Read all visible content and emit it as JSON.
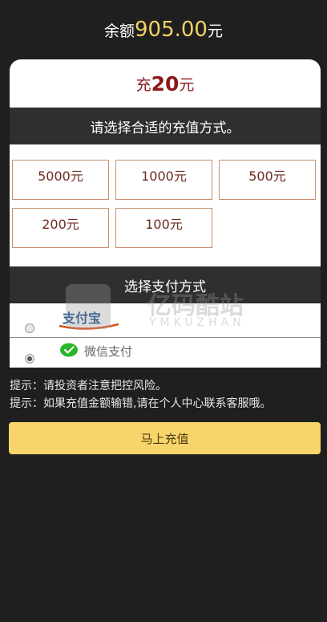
{
  "header": {
    "prefix": "余额",
    "amount": "905.00",
    "suffix": "元"
  },
  "charge": {
    "prefix": "充",
    "amount": "20",
    "suffix": "元"
  },
  "amount_section": {
    "title": "请选择合适的充值方式。",
    "options": [
      "5000元",
      "1000元",
      "500元",
      "200元",
      "100元"
    ]
  },
  "payment_section": {
    "title": "选择支付方式",
    "alipay_logo_text": "支付宝",
    "wechat_label": "微信支付",
    "selected": "wechat"
  },
  "tips": [
    "提示：请投资者注意把控风险。",
    "提示：如果充值金额输错,请在个人中心联系客服哦。"
  ],
  "submit_label": "马上充值",
  "watermark": {
    "cn": "亿码酷站",
    "en": "YMKUZHAN"
  },
  "colors": {
    "accent_gold": "#f1d262",
    "button_bg": "#f8d56a",
    "dark_bg": "#1f1f1f"
  }
}
